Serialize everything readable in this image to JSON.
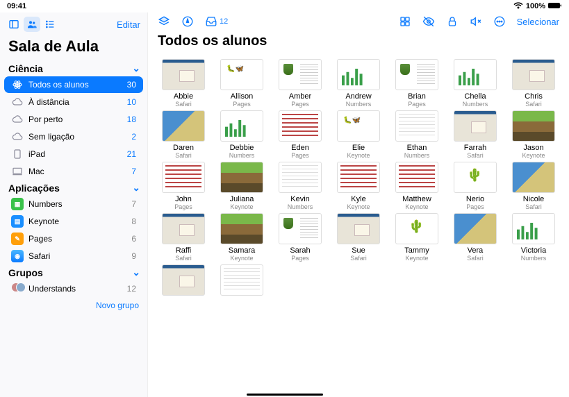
{
  "status": {
    "time": "09:41",
    "battery": "100%",
    "wifi": "wifi-icon"
  },
  "sidebar": {
    "edit": "Editar",
    "title": "Sala de Aula",
    "sections": [
      {
        "header": "Ciência",
        "items": [
          {
            "icon": "atom",
            "label": "Todos os alunos",
            "count": 30,
            "selected": true
          },
          {
            "icon": "cloud-off",
            "label": "À distância",
            "count": 10
          },
          {
            "icon": "cloud-on",
            "label": "Por perto",
            "count": 18
          },
          {
            "icon": "cloud-x",
            "label": "Sem ligação",
            "count": 2
          },
          {
            "icon": "ipad",
            "label": "iPad",
            "count": 21
          },
          {
            "icon": "mac",
            "label": "Mac",
            "count": 7
          }
        ]
      },
      {
        "header": "Aplicações",
        "items": [
          {
            "icon": "app-numbers",
            "label": "Numbers",
            "count": 7
          },
          {
            "icon": "app-keynote",
            "label": "Keynote",
            "count": 8
          },
          {
            "icon": "app-pages",
            "label": "Pages",
            "count": 6
          },
          {
            "icon": "app-safari",
            "label": "Safari",
            "count": 9
          }
        ]
      },
      {
        "header": "Grupos",
        "items": [
          {
            "icon": "avatars",
            "label": "Understands",
            "count": 12
          }
        ]
      }
    ],
    "new_group": "Novo grupo"
  },
  "toolbar": {
    "inbox_count": 12,
    "select": "Selecionar"
  },
  "main": {
    "title": "Todos os alunos",
    "students": [
      {
        "name": "Abbie",
        "app": "Safari",
        "th": "safari"
      },
      {
        "name": "Allison",
        "app": "Pages",
        "th": "bugs"
      },
      {
        "name": "Amber",
        "app": "Pages",
        "th": "pages"
      },
      {
        "name": "Andrew",
        "app": "Numbers",
        "th": "numbers"
      },
      {
        "name": "Brian",
        "app": "Pages",
        "th": "pages"
      },
      {
        "name": "Chella",
        "app": "Numbers",
        "th": "numbers"
      },
      {
        "name": "Chris",
        "app": "Safari",
        "th": "safari"
      },
      {
        "name": "Daren",
        "app": "Safari",
        "th": "map"
      },
      {
        "name": "Debbie",
        "app": "Numbers",
        "th": "numbers"
      },
      {
        "name": "Eden",
        "app": "Pages",
        "th": "keynote"
      },
      {
        "name": "Elie",
        "app": "Keynote",
        "th": "bugs"
      },
      {
        "name": "Ethan",
        "app": "Numbers",
        "th": "sheet"
      },
      {
        "name": "Farrah",
        "app": "Safari",
        "th": "safari"
      },
      {
        "name": "Jason",
        "app": "Keynote",
        "th": "soil"
      },
      {
        "name": "John",
        "app": "Pages",
        "th": "keynote"
      },
      {
        "name": "Juliana",
        "app": "Keynote",
        "th": "soil"
      },
      {
        "name": "Kevin",
        "app": "Numbers",
        "th": "sheet"
      },
      {
        "name": "Kyle",
        "app": "Keynote",
        "th": "keynote"
      },
      {
        "name": "Matthew",
        "app": "Keynote",
        "th": "keynote"
      },
      {
        "name": "Nerio",
        "app": "Pages",
        "th": "cactus"
      },
      {
        "name": "Nicole",
        "app": "Safari",
        "th": "map"
      },
      {
        "name": "Raffi",
        "app": "Safari",
        "th": "safari"
      },
      {
        "name": "Samara",
        "app": "Keynote",
        "th": "soil"
      },
      {
        "name": "Sarah",
        "app": "Pages",
        "th": "pages"
      },
      {
        "name": "Sue",
        "app": "Safari",
        "th": "safari"
      },
      {
        "name": "Tammy",
        "app": "Keynote",
        "th": "cactus"
      },
      {
        "name": "Vera",
        "app": "Safari",
        "th": "map"
      },
      {
        "name": "Victoria",
        "app": "Numbers",
        "th": "numbers"
      },
      {
        "name": "",
        "app": "",
        "th": "safari"
      },
      {
        "name": "",
        "app": "",
        "th": "sheet"
      }
    ]
  },
  "icons": {
    "app_colors": {
      "app-numbers": "#3ac24a",
      "app-keynote": "#1a8fff",
      "app-pages": "#ff9f0a",
      "app-safari": "#1a8fff"
    }
  }
}
